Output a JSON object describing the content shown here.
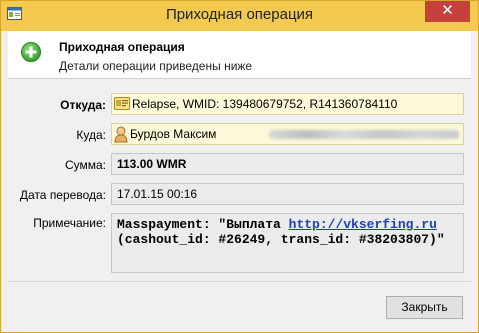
{
  "window": {
    "title": "Приходная операция",
    "close_glyph": "✕"
  },
  "header": {
    "title": "Приходная операция",
    "subtitle": "Детали операции приведены ниже",
    "icon": "add-green-icon"
  },
  "fields": {
    "from": {
      "label": "Откуда:",
      "value": "Relapse, WMID: 139480679752, R141360784110",
      "icon": "wmid-card-icon"
    },
    "to": {
      "label": "Куда:",
      "value": "Бурдов Максим",
      "icon": "person-icon"
    },
    "amount": {
      "label": "Сумма:",
      "value": "113.00 WMR"
    },
    "date": {
      "label": "Дата перевода:",
      "value": "17.01.15 00:16"
    },
    "note": {
      "label": "Примечание:",
      "prefix": "Masspayment: \"Выплата ",
      "link": "http://vkserfing.ru",
      "line2": "(cashout_id: #26249, trans_id: #38203807)\""
    }
  },
  "footer": {
    "close_label": "Закрыть"
  },
  "colors": {
    "title_bar": "#f3c94f",
    "close_button": "#c7413c",
    "link": "#1a3fc8"
  }
}
